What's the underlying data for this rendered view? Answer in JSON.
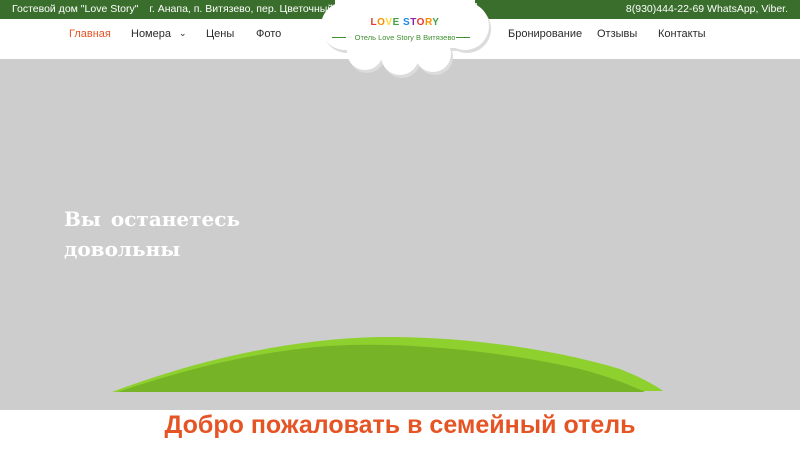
{
  "topbar": {
    "guesthouse": "Гостевой дом \"Love Story\"",
    "address": "г. Анапа, п. Витязево, пер. Цветочный, 1",
    "phone": "8(930)444-22-69 WhatsApp, Viber."
  },
  "nav": {
    "home": "Главная",
    "rooms": "Номера",
    "prices": "Цены",
    "photo": "Фото",
    "booking": "Бронирование",
    "reviews": "Отзывы",
    "contacts": "Контакты"
  },
  "logo": {
    "brand_letters": [
      "L",
      "O",
      "V",
      "E",
      " S",
      "T",
      "O",
      "R",
      "Y"
    ],
    "subtitle": "Отель Love Story В Витязево"
  },
  "hero": {
    "slogan_line1": "Вы останетесь",
    "slogan_line2": "довольны"
  },
  "welcome": {
    "title": "Добро пожаловать в семейный отель"
  },
  "colors": {
    "topbar": "#3a6e2c",
    "accent": "#e55424",
    "hero_bg": "#cdcdcd",
    "hill_light": "#8ed12f",
    "hill_dark": "#77b327"
  }
}
